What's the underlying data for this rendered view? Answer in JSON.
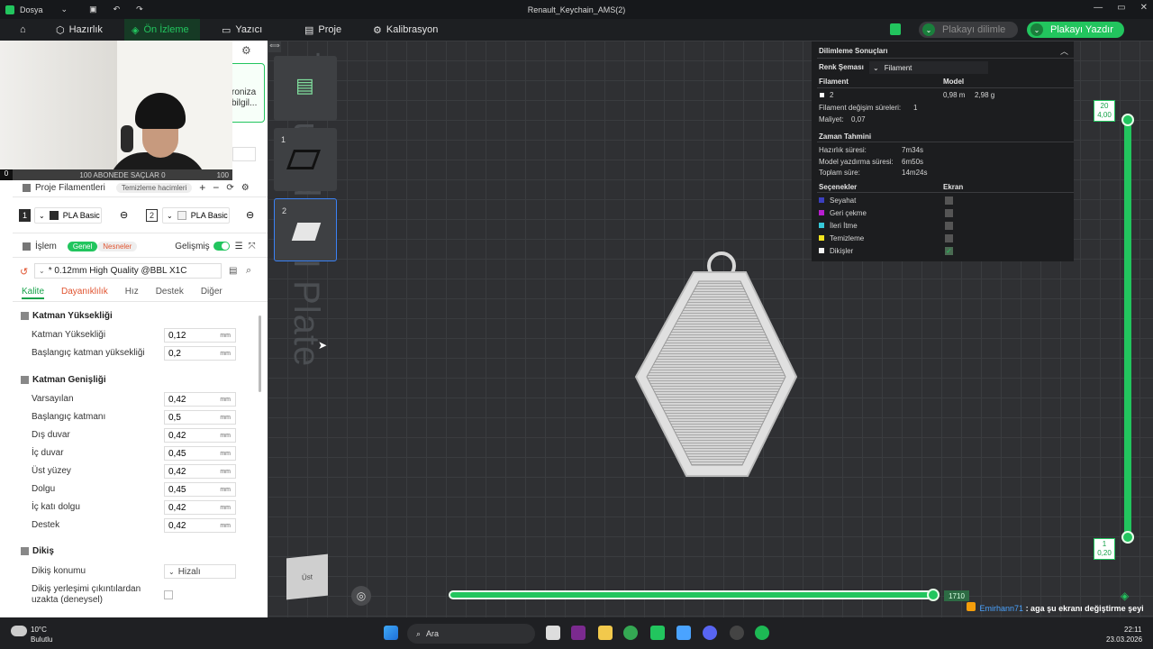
{
  "titlebar": {
    "menu_label": "Dosya",
    "window_title": "Renault_Keychain_AMS(2)"
  },
  "nav": {
    "tabs": [
      "Hazırlık",
      "Ön İzleme",
      "Yazıcı",
      "Proje",
      "Kalibrasyon"
    ],
    "slice_plate": "Plakayı dilimle",
    "print_plate": "Plakayı Yazdır"
  },
  "webcam": {
    "subscriber_bar": "100 ABONEDE SAÇLAR 0",
    "subscriber_count": "100",
    "side_text_1": "roniza",
    "side_text_2": "bilgil..."
  },
  "filaments": {
    "title": "Proje Filamentleri",
    "purge_btn": "Temizleme hacimleri",
    "items": [
      {
        "num": "1",
        "name": "PLA Basic",
        "color": "#2b2b2b"
      },
      {
        "num": "2",
        "name": "PLA Basic",
        "color": "#f2f2f2"
      }
    ]
  },
  "process": {
    "title": "İşlem",
    "tab_general": "Genel",
    "tab_objects": "Nesneler",
    "advanced": "Gelişmiş",
    "profile": "* 0.12mm High Quality @BBL X1C",
    "subtabs": [
      "Kalite",
      "Dayanıklılık",
      "Hız",
      "Destek",
      "Diğer"
    ]
  },
  "layer_height": {
    "title": "Katman Yüksekliği",
    "rows": [
      {
        "label": "Katman Yüksekliği",
        "value": "0,12",
        "unit": "mm"
      },
      {
        "label": "Başlangıç katman yüksekliği",
        "value": "0,2",
        "unit": "mm"
      }
    ]
  },
  "line_width": {
    "title": "Katman Genişliği",
    "rows": [
      {
        "label": "Varsayılan",
        "value": "0,42",
        "unit": "mm"
      },
      {
        "label": "Başlangıç katmanı",
        "value": "0,5",
        "unit": "mm"
      },
      {
        "label": "Dış duvar",
        "value": "0,42",
        "unit": "mm"
      },
      {
        "label": "İç duvar",
        "value": "0,45",
        "unit": "mm"
      },
      {
        "label": "Üst yüzey",
        "value": "0,42",
        "unit": "mm"
      },
      {
        "label": "Dolgu",
        "value": "0,45",
        "unit": "mm"
      },
      {
        "label": "İç katı dolgu",
        "value": "0,42",
        "unit": "mm"
      },
      {
        "label": "Destek",
        "value": "0,42",
        "unit": "mm"
      }
    ]
  },
  "seam": {
    "title": "Dikiş",
    "position_label": "Dikiş konumu",
    "position_value": "Hizalı",
    "avoid_label_1": "Dikiş yerleşimi çıkıntılardan",
    "avoid_label_2": "uzakta (deneysel)"
  },
  "plates": {
    "watermark": "Textured PEI Plate",
    "items": [
      "1",
      "2"
    ]
  },
  "results": {
    "title": "Dilimleme Sonuçları",
    "color_scheme_label": "Renk Şeması",
    "color_scheme_value": "Filament",
    "col_filament": "Filament",
    "col_model": "Model",
    "fil_num": "2",
    "fil_len": "0,98 m",
    "fil_weight": "2,98 g",
    "change_label": "Filament değişim süreleri:",
    "change_value": "1",
    "cost_label": "Maliyet:",
    "cost_value": "0,07",
    "time_title": "Zaman Tahmini",
    "prep_label": "Hazırlık süresi:",
    "prep_value": "7m34s",
    "model_label": "Model yazdırma süresi:",
    "model_value": "6m50s",
    "total_label": "Toplam süre:",
    "total_value": "14m24s",
    "options_title": "Seçenekler",
    "display_title": "Ekran",
    "options": [
      {
        "label": "Seyahat",
        "color": "#3b3fbf",
        "checked": false
      },
      {
        "label": "Geri çekme",
        "color": "#b81fcf",
        "checked": false
      },
      {
        "label": "İleri İtme",
        "color": "#36c9d8",
        "checked": false
      },
      {
        "label": "Temizleme",
        "color": "#f2e41f",
        "checked": false
      },
      {
        "label": "Dikişler",
        "color": "#f4f4f4",
        "checked": true
      }
    ]
  },
  "layer_slider": {
    "top_layer": "20",
    "top_height": "4,00",
    "bottom_layer": "1",
    "bottom_height": "0,20"
  },
  "move_slider": {
    "value": "1710"
  },
  "view_cube": {
    "label": "Üst"
  },
  "chat": {
    "user": "Emirhann71",
    "message": ": aga şu ekranı değiştirme şeyi yapsana hep böyle kamerayı büyültmek yerine"
  },
  "taskbar": {
    "weather_temp": "10°C",
    "weather_desc": "Bulutlu",
    "search": "Ara",
    "time": "22:11",
    "date": "23.03.2026"
  }
}
